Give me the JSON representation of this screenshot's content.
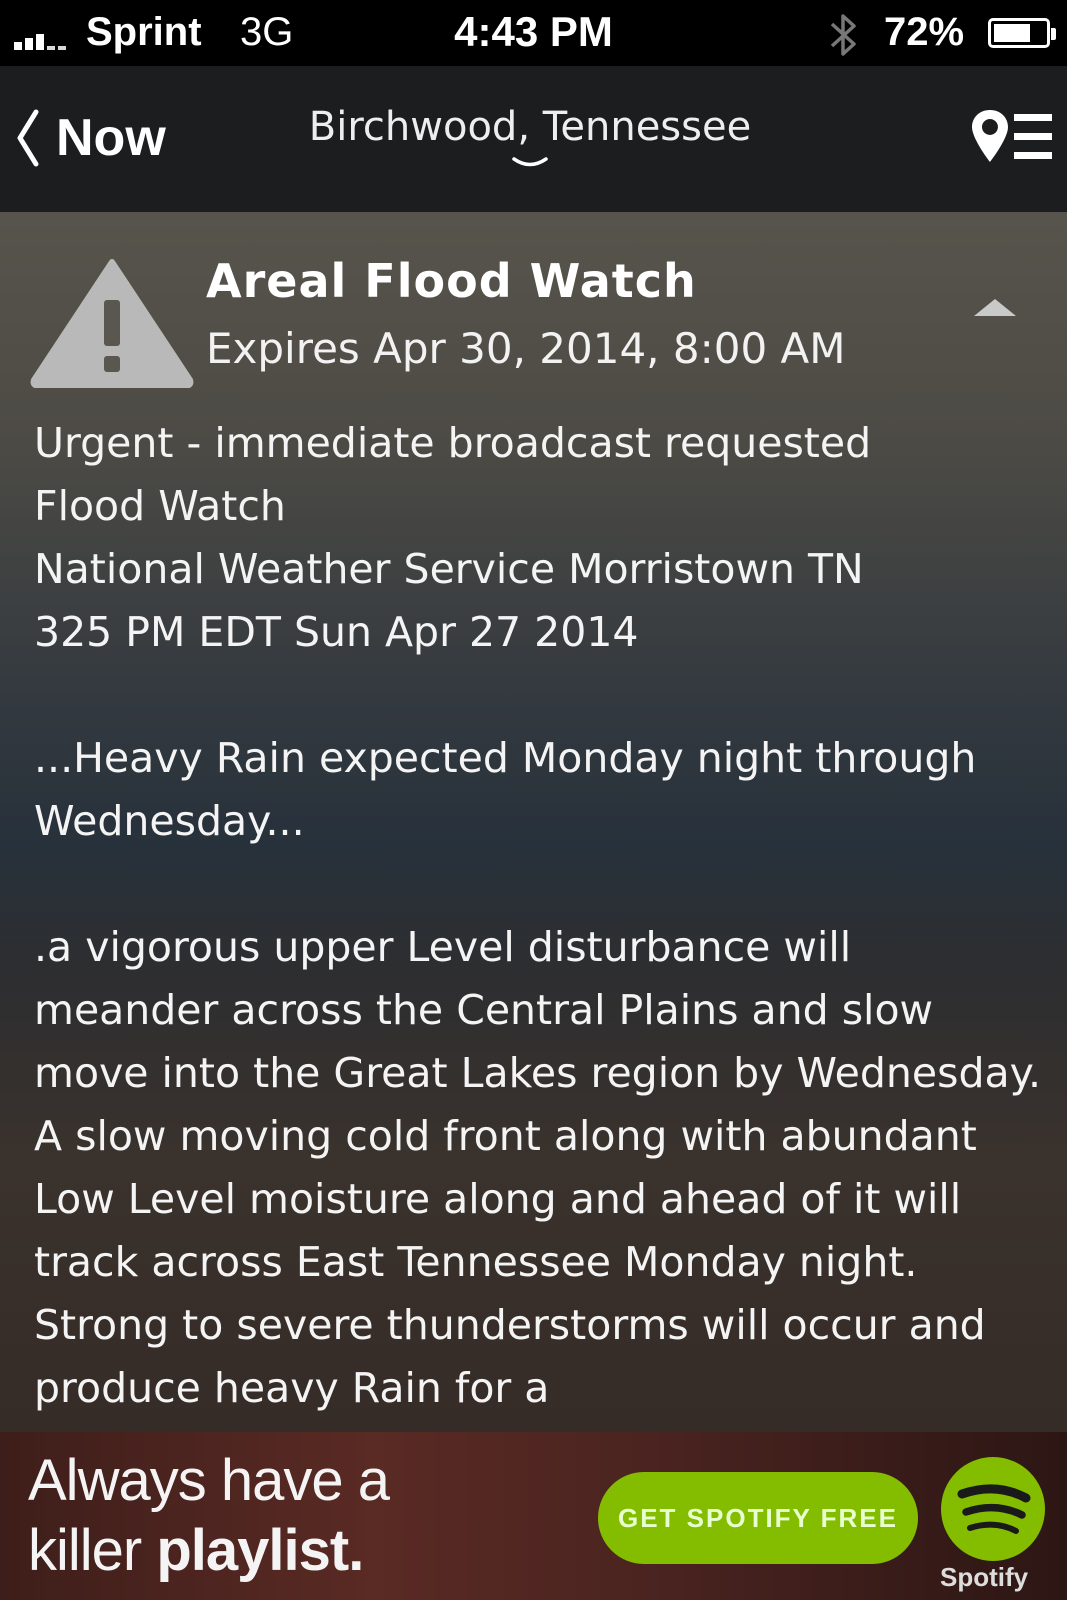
{
  "status_bar": {
    "carrier": "Sprint",
    "network": "3G",
    "time": "4:43 PM",
    "battery_percent": "72%",
    "battery_level": 0.72,
    "icons": [
      "signal-icon",
      "bluetooth-icon",
      "battery-icon"
    ]
  },
  "nav": {
    "back_label": "Now",
    "location": "Birchwood, Tennessee",
    "icons": [
      "back-chevron-icon",
      "chevron-down-icon",
      "location-list-icon"
    ]
  },
  "alert": {
    "title": "Areal Flood Watch",
    "expires": "Expires Apr 30, 2014, 8:00 AM",
    "icons": [
      "warning-icon",
      "collapse-arrow-icon"
    ],
    "body": [
      "Urgent - immediate broadcast requested",
      "Flood Watch",
      "National Weather Service Morristown TN",
      "325 PM EDT Sun Apr 27 2014",
      "",
      "...Heavy Rain expected Monday night through Wednesday...",
      "",
      ".a vigorous upper Level disturbance will meander across the Central Plains and slow move into the Great Lakes region by Wednesday. A slow moving cold front along with abundant Low Level moisture along and ahead of it will track across East Tennessee Monday night. Strong to severe thunderstorms will occur and produce heavy Rain for a"
    ]
  },
  "ad": {
    "line1": "Always have a",
    "line2_plain": "killer ",
    "line2_bold": "playlist.",
    "cta": "GET SPOTIFY FREE",
    "brand": "Spotify",
    "colors": {
      "cta": "#84bd00"
    }
  }
}
